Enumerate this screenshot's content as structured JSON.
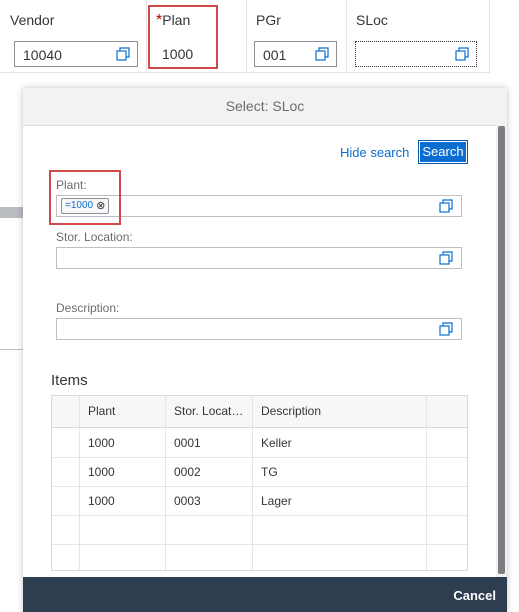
{
  "background_table": {
    "columns": [
      {
        "label": "Vendor",
        "required": false,
        "value": "10040"
      },
      {
        "label": "Plan",
        "required": true,
        "required_mark": "*",
        "value": "1000"
      },
      {
        "label": "PGr",
        "required": false,
        "value": "001"
      },
      {
        "label": "SLoc",
        "required": false,
        "value": ""
      }
    ]
  },
  "dialog": {
    "title": "Select: SLoc",
    "hide_search_label": "Hide search",
    "search_label": "Search",
    "fields": {
      "plant": {
        "label": "Plant:",
        "token": "=1000",
        "token_close": "⊗"
      },
      "stor_location": {
        "label": "Stor. Location:",
        "value": ""
      },
      "description": {
        "label": "Description:",
        "value": ""
      }
    },
    "items": {
      "title": "Items",
      "headers": [
        "Plant",
        "Stor. Locat…",
        "Description"
      ],
      "rows": [
        [
          "1000",
          "0001",
          "Keller"
        ],
        [
          "1000",
          "0002",
          "TG"
        ],
        [
          "1000",
          "0003",
          "Lager"
        ]
      ]
    },
    "cancel_label": "Cancel"
  },
  "colors": {
    "accent": "#0a6ed1",
    "highlight": "#d04a4a",
    "required": "#bb0000",
    "footer": "#2c3e50"
  },
  "icons": {
    "value_help": "value-help-icon"
  }
}
